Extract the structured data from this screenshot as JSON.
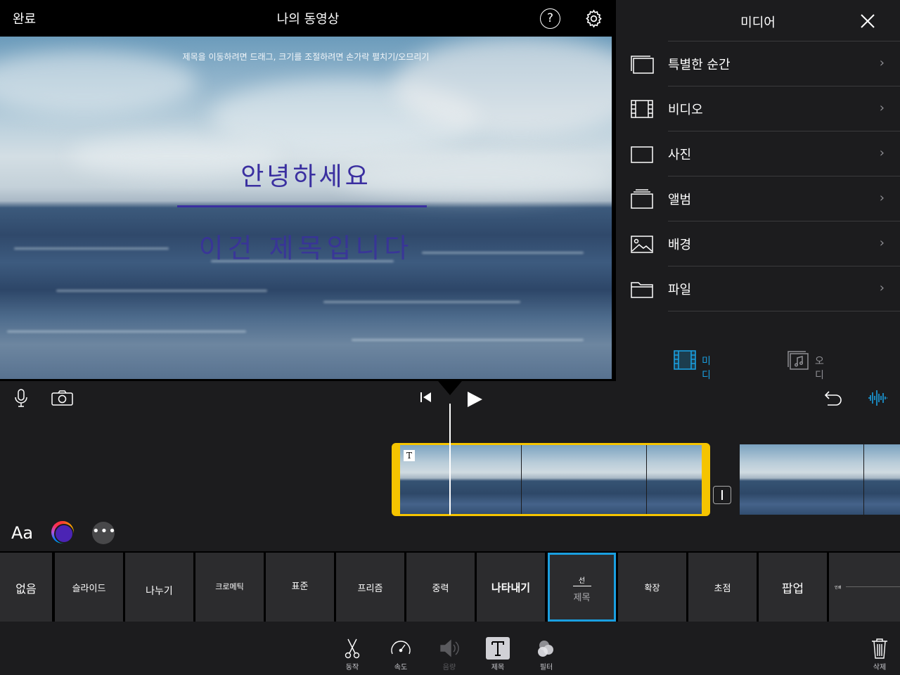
{
  "topbar": {
    "done_label": "완료",
    "project_title": "나의 동영상",
    "help_label": "?"
  },
  "preview": {
    "hint": "제목을 이동하려면 드래그, 크기를 조절하려면 손가락 펼치기/오므리기",
    "title_line1": "안녕하세요",
    "title_line2": "이건 제목입니다",
    "title_color": "#3a2fa0"
  },
  "media_panel": {
    "title": "미디어",
    "items": [
      {
        "label": "특별한 순간",
        "icon": "moments-icon"
      },
      {
        "label": "비디오",
        "icon": "film-icon"
      },
      {
        "label": "사진",
        "icon": "photo-icon"
      },
      {
        "label": "앨범",
        "icon": "album-icon"
      },
      {
        "label": "배경",
        "icon": "background-icon"
      },
      {
        "label": "파일",
        "icon": "folder-icon"
      }
    ],
    "tabs": [
      {
        "label": "미디어",
        "active": true
      },
      {
        "label": "오디오",
        "active": false
      }
    ],
    "accent": "#1a9fe0"
  },
  "style_bar": {
    "font_label": "Aa",
    "more_label": "•••"
  },
  "title_styles": [
    {
      "label": "없음"
    },
    {
      "label": "슬라이드"
    },
    {
      "label": "나누기"
    },
    {
      "label": "크로메틱"
    },
    {
      "label": "표준"
    },
    {
      "label": "프리즘"
    },
    {
      "label": "중력"
    },
    {
      "label": "나타내기"
    },
    {
      "label": "선",
      "sublabel": "제목",
      "selected": true
    },
    {
      "label": "확장"
    },
    {
      "label": "초점"
    },
    {
      "label": "팝업"
    },
    {
      "label": "인쇄"
    }
  ],
  "toolbar": {
    "tools": [
      {
        "label": "동작",
        "icon": "scissors-icon"
      },
      {
        "label": "속도",
        "icon": "speedometer-icon"
      },
      {
        "label": "음량",
        "icon": "speaker-icon",
        "disabled": true
      },
      {
        "label": "제목",
        "icon": "title-t-icon",
        "active": true
      },
      {
        "label": "필터",
        "icon": "filter-icon"
      }
    ],
    "delete_label": "삭제"
  },
  "timeline": {
    "clip_badge": "T"
  }
}
